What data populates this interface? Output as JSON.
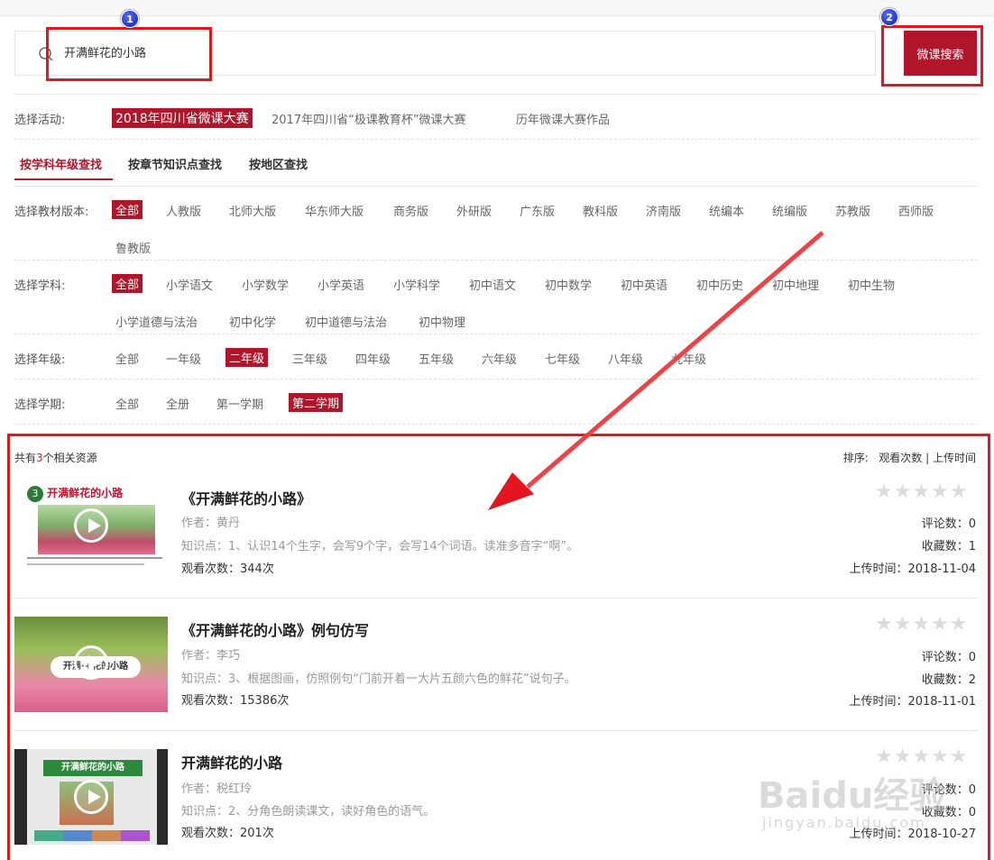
{
  "search": {
    "value": "开满鲜花的小路",
    "button_label": "微课搜索"
  },
  "annotations": {
    "badge_1": "1",
    "badge_2": "2"
  },
  "activity": {
    "label": "选择活动:",
    "options": [
      "2018年四川省微课大赛",
      "2017年四川省“极课教育杯”微课大赛",
      "历年微课大赛作品"
    ]
  },
  "tabs": [
    "按学科年级查找",
    "按章节知识点查找",
    "按地区查找"
  ],
  "edition": {
    "label": "选择教材版本:",
    "options": [
      "全部",
      "人教版",
      "北师大版",
      "华东师大版",
      "商务版",
      "外研版",
      "广东版",
      "教科版",
      "济南版",
      "统编本",
      "统编版",
      "苏教版",
      "西师版",
      "鲁教版"
    ]
  },
  "subject": {
    "label": "选择学科:",
    "options": [
      "全部",
      "小学语文",
      "小学数学",
      "小学英语",
      "小学科学",
      "初中语文",
      "初中数学",
      "初中英语",
      "初中历史",
      "初中地理",
      "初中生物",
      "小学道德与法治",
      "初中化学",
      "初中道德与法治",
      "初中物理"
    ]
  },
  "grade": {
    "label": "选择年级:",
    "options": [
      "全部",
      "一年级",
      "二年级",
      "三年级",
      "四年级",
      "五年级",
      "六年级",
      "七年级",
      "八年级",
      "九年级"
    ]
  },
  "term": {
    "label": "选择学期:",
    "options": [
      "全部",
      "全册",
      "第一学期",
      "第二学期"
    ]
  },
  "results": {
    "count_prefix": "共有",
    "count": "3",
    "count_suffix": "个相关资源",
    "sort_label": "排序:",
    "sort_views": "观看次数",
    "sort_sep": "|",
    "sort_time": "上传时间",
    "items": [
      {
        "title": "《开满鲜花的小路》",
        "author": "作者：黄丹",
        "knowledge": "知识点：1、认识14个生字，会写9个字，会写14个词语。读准多音字“啊”。",
        "views": "观看次数：344次",
        "stars": "★★★★★",
        "comments": "评论数：0",
        "favorites": "收藏数：1",
        "upload": "上传时间：2018-11-04",
        "thumb_text": "开满鲜花的小路"
      },
      {
        "title": "《开满鲜花的小路》例句仿写",
        "author": "作者：李巧",
        "knowledge": "知识点：3、根据图画，仿照例句“门前开着一大片五颜六色的鲜花”说句子。",
        "views": "观看次数：15386次",
        "stars": "★★★★★",
        "comments": "评论数：0",
        "favorites": "收藏数：2",
        "upload": "上传时间：2018-11-01",
        "thumb_text": "开满·+花的小路"
      },
      {
        "title": "开满鲜花的小路",
        "author": "作者：税红玲",
        "knowledge": "知识点：2、分角色朗读课文，读好角色的语气。",
        "views": "观看次数：201次",
        "stars": "★★★★★",
        "comments": "评论数：0",
        "favorites": "收藏数：0",
        "upload": "上传时间：2018-10-27",
        "thumb_text": "开满鲜花的小路"
      }
    ]
  },
  "watermark": {
    "main": "Baidu经验",
    "sub": "jingyan.baidu.com"
  },
  "colors": {
    "accent": "#b0162b",
    "annotation": "#e4151f",
    "badge": "#1a2fd1"
  }
}
